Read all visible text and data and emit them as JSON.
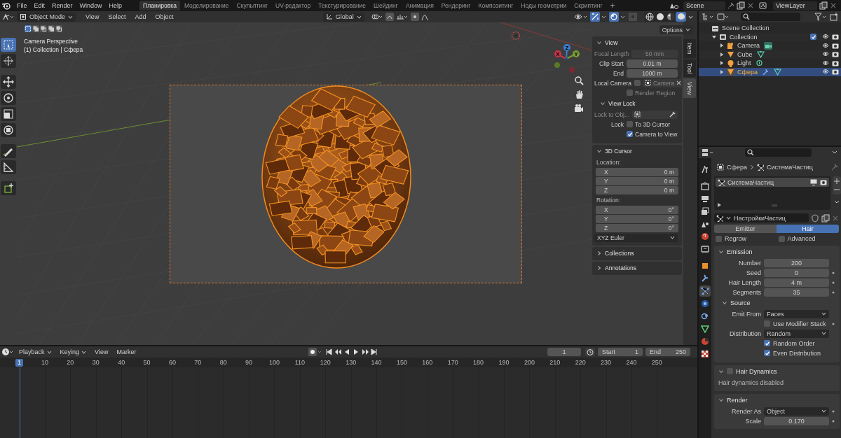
{
  "topbar": {
    "menus": [
      "File",
      "Edit",
      "Render",
      "Window",
      "Help"
    ],
    "workspaces": [
      {
        "label": "Планировка",
        "selected": true
      },
      {
        "label": "Моделирование",
        "selected": false
      },
      {
        "label": "Скульптинг",
        "selected": false
      },
      {
        "label": "UV-редактор",
        "selected": false
      },
      {
        "label": "Текстурирование",
        "selected": false
      },
      {
        "label": "Шейдинг",
        "selected": false
      },
      {
        "label": "Анимация",
        "selected": false
      },
      {
        "label": "Рендеринг",
        "selected": false
      },
      {
        "label": "Композитинг",
        "selected": false
      },
      {
        "label": "Ноды геометрии",
        "selected": false
      },
      {
        "label": "Скриптинг",
        "selected": false
      }
    ],
    "add_workspace": "+",
    "scene": "Scene",
    "view_layer": "ViewLayer"
  },
  "viewport": {
    "mode": "Object Mode",
    "menus": [
      "View",
      "Select",
      "Add",
      "Object"
    ],
    "orientation": "Global",
    "options": "Options",
    "select_modes": [
      {
        "selected": true
      },
      {
        "selected": false
      },
      {
        "selected": false
      },
      {
        "selected": false
      },
      {
        "selected": false
      }
    ],
    "tools": [
      {
        "kind": "select",
        "selected": true
      },
      {
        "kind": "cursor",
        "selected": false
      },
      {
        "kind": "move",
        "selected": false
      },
      {
        "kind": "rotate",
        "selected": false
      },
      {
        "kind": "scale",
        "selected": false
      },
      {
        "kind": "transform",
        "selected": false
      },
      {
        "kind": "annotate",
        "selected": false
      },
      {
        "kind": "measure",
        "selected": false
      },
      {
        "kind": "add_cube",
        "selected": false
      }
    ],
    "shading": [
      {
        "kind": "wireframe",
        "selected": false
      },
      {
        "kind": "solid",
        "selected": false
      },
      {
        "kind": "material",
        "selected": false
      },
      {
        "kind": "rendered",
        "selected": true
      }
    ],
    "info": [
      "Camera Perspective",
      "(1) Collection | Сфера"
    ],
    "gizmo_axes": [
      "X",
      "Y",
      "Z"
    ],
    "sidebar_tabs": [
      {
        "label": "Item",
        "selected": false
      },
      {
        "label": "Tool",
        "selected": false
      },
      {
        "label": "View",
        "selected": true
      }
    ],
    "sidebar": [
      {
        "title": "View",
        "expanded": true,
        "rows": [
          {
            "kind": "field",
            "label": "Focal Length",
            "value": "50 mm",
            "disabled": true
          },
          {
            "kind": "field",
            "label": "Clip Start",
            "value": "0.01 m"
          },
          {
            "kind": "field",
            "label": "End",
            "value": "1000 m"
          },
          {
            "kind": "object",
            "label": "Local Camera",
            "checked": false,
            "value": "Camera"
          },
          {
            "kind": "checkbox",
            "label": "Render Region",
            "checked": false,
            "disabled": true
          },
          {
            "kind": "subpanel",
            "title": "View Lock",
            "expanded": true,
            "rows": [
              {
                "kind": "picker",
                "label": "Lock to Obj...",
                "disabled": true
              },
              {
                "kind": "checkbox",
                "label_left": "Lock",
                "label": "To 3D Cursor",
                "checked": false
              },
              {
                "kind": "checkbox",
                "label": "Camera to View",
                "checked": true
              }
            ]
          }
        ]
      },
      {
        "title": "3D Cursor",
        "expanded": true,
        "rows": [
          {
            "kind": "caption",
            "text": "Location:"
          },
          {
            "kind": "vector",
            "items": [
              {
                "label": "X",
                "value": "0 m"
              },
              {
                "label": "Y",
                "value": "0 m"
              },
              {
                "label": "Z",
                "value": "0 m"
              }
            ]
          },
          {
            "kind": "caption",
            "text": "Rotation:"
          },
          {
            "kind": "vector",
            "items": [
              {
                "label": "X",
                "value": "0°"
              },
              {
                "label": "Y",
                "value": "0°"
              },
              {
                "label": "Z",
                "value": "0°"
              }
            ]
          },
          {
            "kind": "select",
            "value": "XYZ Euler"
          }
        ]
      },
      {
        "title": "Collections",
        "expanded": false
      },
      {
        "title": "Annotations",
        "expanded": false
      }
    ]
  },
  "timeline": {
    "menus": [
      {
        "label": "Playback",
        "dropdown": true
      },
      {
        "label": "Keying",
        "dropdown": true
      },
      {
        "label": "View",
        "dropdown": false
      },
      {
        "label": "Marker",
        "dropdown": false
      }
    ],
    "current_frame": "1",
    "start_label": "Start",
    "start": "1",
    "end_label": "End",
    "end": "250",
    "ruler": [
      {
        "label": "1",
        "selected": true
      },
      {
        "label": "10",
        "selected": false
      },
      {
        "label": "20",
        "selected": false
      },
      {
        "label": "30",
        "selected": false
      },
      {
        "label": "40",
        "selected": false
      },
      {
        "label": "50",
        "selected": false
      },
      {
        "label": "60",
        "selected": false
      },
      {
        "label": "70",
        "selected": false
      },
      {
        "label": "80",
        "selected": false
      },
      {
        "label": "90",
        "selected": false
      },
      {
        "label": "100",
        "selected": false
      },
      {
        "label": "110",
        "selected": false
      },
      {
        "label": "120",
        "selected": false
      },
      {
        "label": "130",
        "selected": false
      },
      {
        "label": "140",
        "selected": false
      },
      {
        "label": "150",
        "selected": false
      },
      {
        "label": "160",
        "selected": false
      },
      {
        "label": "170",
        "selected": false
      },
      {
        "label": "180",
        "selected": false
      },
      {
        "label": "190",
        "selected": false
      },
      {
        "label": "200",
        "selected": false
      },
      {
        "label": "210",
        "selected": false
      },
      {
        "label": "220",
        "selected": false
      },
      {
        "label": "230",
        "selected": false
      },
      {
        "label": "240",
        "selected": false
      },
      {
        "label": "250",
        "selected": false
      }
    ]
  },
  "outliner": {
    "tree": [
      {
        "label": "Scene Collection",
        "kind": "scene",
        "children": [
          {
            "label": "Collection",
            "kind": "collection",
            "expanded": true,
            "checked": true,
            "children": [
              {
                "label": "Camera",
                "kind": "camera",
                "expanded": false,
                "selected": false
              },
              {
                "label": "Cube",
                "kind": "mesh",
                "expanded": false,
                "selected": false
              },
              {
                "label": "Light",
                "kind": "light",
                "expanded": false,
                "selected": false
              },
              {
                "label": "Сфера",
                "kind": "mesh_particles",
                "expanded": false,
                "selected": true
              }
            ]
          }
        ]
      }
    ]
  },
  "properties": {
    "tabs": [
      {
        "kind": "tool",
        "selected": false
      },
      {
        "kind": "render",
        "selected": false
      },
      {
        "kind": "output",
        "selected": false
      },
      {
        "kind": "view_layer",
        "selected": false
      },
      {
        "kind": "scene",
        "selected": false
      },
      {
        "kind": "world",
        "selected": false
      },
      {
        "kind": "collection",
        "selected": false
      },
      {
        "kind": "object",
        "selected": false
      },
      {
        "kind": "modifiers",
        "selected": false
      },
      {
        "kind": "particles",
        "selected": true
      },
      {
        "kind": "physics",
        "selected": false
      },
      {
        "kind": "constraints",
        "selected": false
      },
      {
        "kind": "data",
        "selected": false
      },
      {
        "kind": "material",
        "selected": false
      },
      {
        "kind": "texture",
        "selected": false
      }
    ],
    "breadcrumb": [
      "Сфера",
      "СистемаЧастиц"
    ],
    "systems": [
      {
        "name": "СистемаЧастиц",
        "selected": true
      }
    ],
    "settings": "НастройкиЧастиц",
    "types": [
      {
        "label": "Emitter",
        "selected": false
      },
      {
        "label": "Hair",
        "selected": true
      }
    ],
    "options": [
      {
        "label": "Regrow",
        "checked": false
      },
      {
        "label": "Advanced",
        "checked": false
      }
    ],
    "panels": [
      {
        "title": "Emission",
        "expanded": true,
        "rows": [
          {
            "kind": "field",
            "label": "Number",
            "value": "200"
          },
          {
            "kind": "field",
            "label": "Seed",
            "value": "0",
            "decorator": true
          },
          {
            "kind": "field",
            "label": "Hair Length",
            "value": "4 m",
            "decorator": true
          },
          {
            "kind": "field",
            "label": "Segments",
            "value": "35",
            "decorator": true
          },
          {
            "kind": "subpanel",
            "title": "Source",
            "expanded": true,
            "rows": [
              {
                "kind": "select",
                "label": "Emit From",
                "value": "Faces"
              },
              {
                "kind": "checkbox",
                "label": "Use Modifier Stack",
                "checked": false,
                "decorator": true
              },
              {
                "kind": "select",
                "label": "Distribution",
                "value": "Random"
              },
              {
                "kind": "checkbox",
                "label": "Random Order",
                "checked": true
              },
              {
                "kind": "checkbox",
                "label": "Even Distribution",
                "checked": true
              }
            ]
          }
        ]
      },
      {
        "title": "Hair Dynamics",
        "expanded": true,
        "checked": false,
        "rows": [
          {
            "kind": "text",
            "text": "Hair dynamics disabled"
          }
        ]
      },
      {
        "title": "Render",
        "expanded": true,
        "rows": [
          {
            "kind": "select",
            "label": "Render As",
            "value": "Object",
            "decorator": true
          },
          {
            "kind": "field",
            "label": "Scale",
            "value": "0.170",
            "decorator": true
          }
        ]
      }
    ]
  }
}
